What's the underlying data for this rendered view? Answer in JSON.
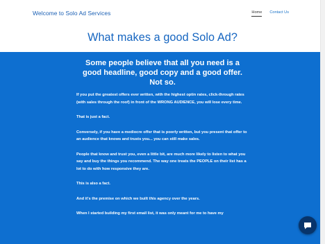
{
  "header": {
    "site_title": "Welcome to Solo Ad Services",
    "nav": [
      {
        "label": "Home",
        "active": true
      },
      {
        "label": "Contact Us",
        "active": false
      }
    ]
  },
  "hero": {
    "title": "What makes a good Solo Ad?"
  },
  "content": {
    "lead": "Some people believe that all you need is a good headline, good copy and a good offer. Not so.",
    "paragraphs": [
      "If you put the greatest offers ever written, with the highest optin rates, click-through rates (with sales through the roof) in front of the WRONG AUDIENCE, you will lose every time.",
      "That is just a fact.",
      "Conversely, if you have a mediocre offer that is poorly written, but you present that offer to an audience that knows and trusts you... you can still make sales.",
      "People that know and trust you, even a little bit, are much more likely to listen to what you say and buy the things you recommend. The way one treats the PEOPLE on their list has a lot to do with how responsive they are.",
      "This is also a fact.",
      "And it's the premise on which we built this agency over the years.",
      "When I started building my first email list, it was only meant for me to have my"
    ]
  },
  "chat_widget": {
    "icon": "chat-bubble-icon"
  },
  "colors": {
    "accent_blue": "#0e6fd0",
    "title_blue": "#1565c0",
    "chat_button": "#07346b"
  }
}
